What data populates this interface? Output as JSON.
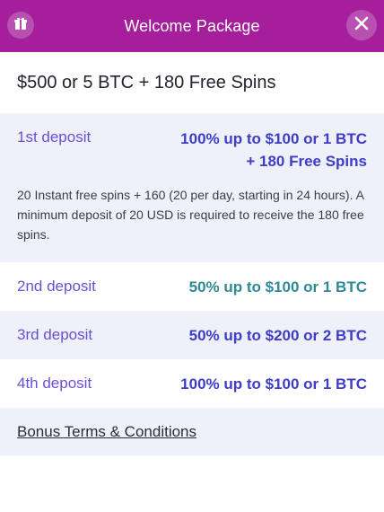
{
  "header": {
    "title": "Welcome Package",
    "colors": {
      "background": "#a51f9c",
      "text": "#ffffff"
    },
    "left_icon": "gift-icon",
    "right_icon": "close-icon"
  },
  "headline": "$500 or 5 BTC + 180 Free Spins",
  "deposits": [
    {
      "label": "1st deposit",
      "value_line1": "100% up to $100 or 1 BTC",
      "value_line2": "+ 180 Free Spins",
      "description": "20 Instant free spins + 160 (20 per day, starting in 24 hours). A minimum deposit of 20 USD is required to receive the 180 free spins."
    },
    {
      "label": "2nd deposit",
      "value": "50% up to $100 or 1 BTC"
    },
    {
      "label": "3rd deposit",
      "value": "50% up to $200 or 2 BTC"
    },
    {
      "label": "4th deposit",
      "value": "100% up to $100 or 1 BTC"
    }
  ],
  "terms_link": "Bonus Terms & Conditions",
  "colors": {
    "label": "#6a4fd6",
    "value": "#3f3cc8",
    "value_teal": "#2f8a95",
    "row_alt_bg": "#eef1f9"
  }
}
